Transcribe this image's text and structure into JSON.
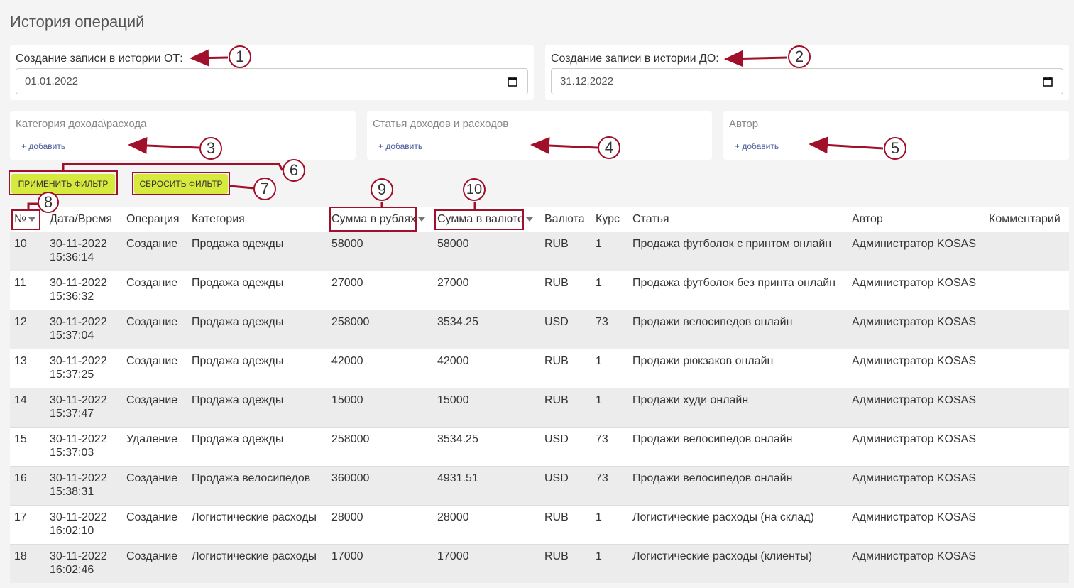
{
  "page": {
    "title": "История операций"
  },
  "filters": {
    "date_from": {
      "label": "Создание записи в истории ОТ:",
      "value": "01.01.2022"
    },
    "date_to": {
      "label": "Создание записи в истории ДО:",
      "value": "31.12.2022"
    },
    "category": {
      "label": "Категория дохода\\расхода",
      "add": "+ добавить"
    },
    "article": {
      "label": "Статья доходов и расходов",
      "add": "+ добавить"
    },
    "author": {
      "label": "Автор",
      "add": "+ добавить"
    },
    "apply_label": "ПРИМЕНИТЬ ФИЛЬТР",
    "reset_label": "СБРОСИТЬ ФИЛЬТР"
  },
  "annotations": [
    "1",
    "2",
    "3",
    "4",
    "5",
    "6",
    "7",
    "8",
    "9",
    "10"
  ],
  "colors": {
    "accent": "#d6e93d",
    "annotation": "#a0102a",
    "row_alt": "#ececec"
  },
  "table": {
    "columns": [
      "№",
      "Дата/Время",
      "Операция",
      "Категория",
      "Сумма в рублях",
      "Сумма в валюте",
      "Валюта",
      "Курс",
      "Статья",
      "Автор",
      "Комментарий"
    ],
    "rows": [
      {
        "n": "10",
        "date": "30-11-2022",
        "time": "15:36:14",
        "op": "Создание",
        "cat": "Продажа одежды",
        "rub": "58000",
        "cur": "58000",
        "code": "RUB",
        "rate": "1",
        "article": "Продажа футболок с принтом онлайн",
        "author": "Администратор KOSAS",
        "comment": ""
      },
      {
        "n": "11",
        "date": "30-11-2022",
        "time": "15:36:32",
        "op": "Создание",
        "cat": "Продажа одежды",
        "rub": "27000",
        "cur": "27000",
        "code": "RUB",
        "rate": "1",
        "article": "Продажа футболок без принта онлайн",
        "author": "Администратор KOSAS",
        "comment": ""
      },
      {
        "n": "12",
        "date": "30-11-2022",
        "time": "15:37:04",
        "op": "Создание",
        "cat": "Продажа одежды",
        "rub": "258000",
        "cur": "3534.25",
        "code": "USD",
        "rate": "73",
        "article": "Продажи велосипедов онлайн",
        "author": "Администратор KOSAS",
        "comment": ""
      },
      {
        "n": "13",
        "date": "30-11-2022",
        "time": "15:37:25",
        "op": "Создание",
        "cat": "Продажа одежды",
        "rub": "42000",
        "cur": "42000",
        "code": "RUB",
        "rate": "1",
        "article": "Продажи рюкзаков онлайн",
        "author": "Администратор KOSAS",
        "comment": ""
      },
      {
        "n": "14",
        "date": "30-11-2022",
        "time": "15:37:47",
        "op": "Создание",
        "cat": "Продажа одежды",
        "rub": "15000",
        "cur": "15000",
        "code": "RUB",
        "rate": "1",
        "article": "Продажи худи онлайн",
        "author": "Администратор KOSAS",
        "comment": ""
      },
      {
        "n": "15",
        "date": "30-11-2022",
        "time": "15:37:03",
        "op": "Удаление",
        "cat": "Продажа одежды",
        "rub": "258000",
        "cur": "3534.25",
        "code": "USD",
        "rate": "73",
        "article": "Продажи велосипедов онлайн",
        "author": "Администратор KOSAS",
        "comment": ""
      },
      {
        "n": "16",
        "date": "30-11-2022",
        "time": "15:38:31",
        "op": "Создание",
        "cat": "Продажа велосипедов",
        "rub": "360000",
        "cur": "4931.51",
        "code": "USD",
        "rate": "73",
        "article": "Продажи велосипедов онлайн",
        "author": "Администратор KOSAS",
        "comment": ""
      },
      {
        "n": "17",
        "date": "30-11-2022",
        "time": "16:02:10",
        "op": "Создание",
        "cat": "Логистические расходы",
        "rub": "28000",
        "cur": "28000",
        "code": "RUB",
        "rate": "1",
        "article": "Логистические расходы (на склад)",
        "author": "Администратор KOSAS",
        "comment": ""
      },
      {
        "n": "18",
        "date": "30-11-2022",
        "time": "16:02:46",
        "op": "Создание",
        "cat": "Логистические расходы",
        "rub": "17000",
        "cur": "17000",
        "code": "RUB",
        "rate": "1",
        "article": "Логистические расходы (клиенты)",
        "author": "Администратор KOSAS",
        "comment": ""
      }
    ]
  }
}
